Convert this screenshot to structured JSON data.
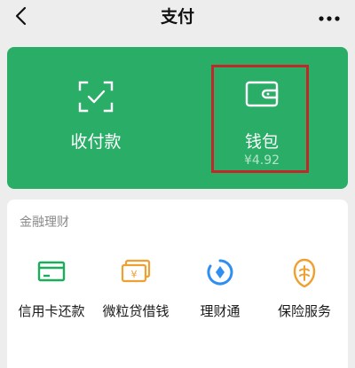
{
  "header": {
    "title": "支付",
    "back_icon": "chevron-left-icon",
    "more_icon": "more-dots-icon"
  },
  "top_card": {
    "color": "#2aae67",
    "items": [
      {
        "label": "收付款",
        "icon": "scan-check-icon"
      },
      {
        "label": "钱包",
        "amount": "¥4.92",
        "icon": "wallet-icon"
      }
    ],
    "highlight_color": "#c0282a"
  },
  "finance": {
    "section_title": "金融理财",
    "items": [
      {
        "label": "信用卡还款",
        "icon": "credit-card-icon",
        "color": "#1aad5a"
      },
      {
        "label": "微粒贷借钱",
        "icon": "loan-icon",
        "color": "#f0a030"
      },
      {
        "label": "理财通",
        "icon": "wealth-icon",
        "color": "#2f8ff0"
      },
      {
        "label": "保险服务",
        "icon": "insurance-icon",
        "color": "#f0a030"
      }
    ]
  }
}
